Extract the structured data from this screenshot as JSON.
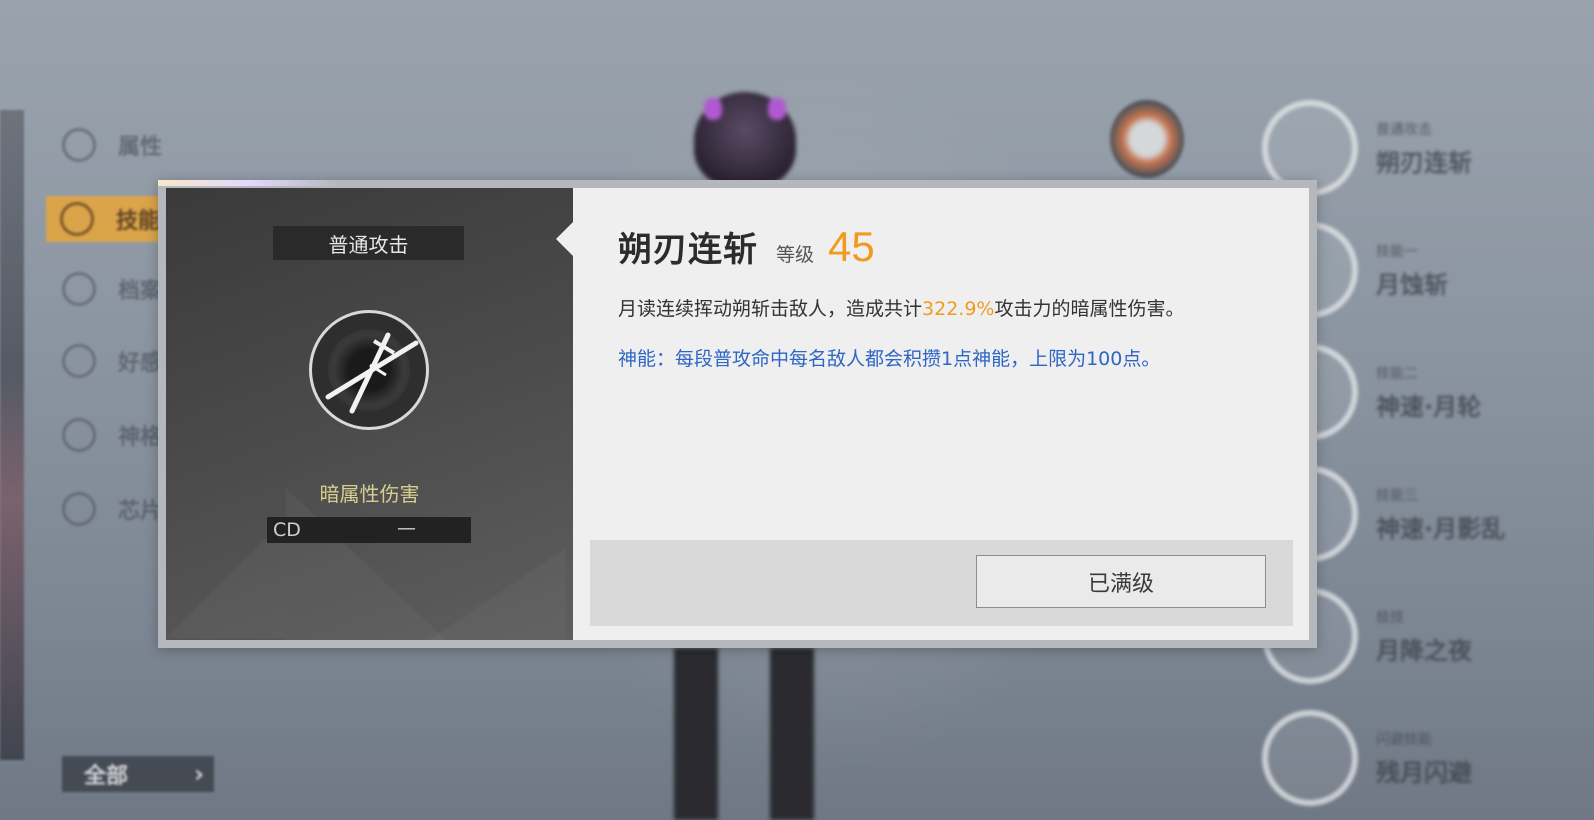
{
  "background": {
    "menu": [
      {
        "label": "属性",
        "active": false
      },
      {
        "label": "技能",
        "active": true
      },
      {
        "label": "档案",
        "active": false
      },
      {
        "label": "好感",
        "active": false
      },
      {
        "label": "神格",
        "active": false
      },
      {
        "label": "芯片",
        "active": false
      }
    ],
    "all_button": "全部",
    "skill_tree": [
      {
        "sub": "普通攻击",
        "name": "朔刃连斩"
      },
      {
        "sub": "技能一",
        "name": "月蚀斩"
      },
      {
        "sub": "技能二",
        "name": "神速·月轮"
      },
      {
        "sub": "技能三",
        "name": "神速·月影乱"
      },
      {
        "sub": "极技",
        "name": "月降之夜"
      },
      {
        "sub": "闪避技能",
        "name": "残月闪避"
      }
    ]
  },
  "dialog": {
    "skill_type": "普通攻击",
    "element": "暗属性伤害",
    "cd_label": "CD",
    "cd_value": "—",
    "skill_name": "朔刃连斩",
    "level_label": "等级",
    "level_value": "45",
    "desc_prefix": "月读连续挥动朔斩击敌人，造成共计",
    "desc_highlight": "322.9%",
    "desc_suffix": "攻击力的暗属性伤害。",
    "extra": "神能：每段普攻命中每名敌人都会积攒1点神能，上限为100点。",
    "max_button": "已满级"
  },
  "colors": {
    "accent_orange": "#f29a1f",
    "extra_blue": "#2f66c4",
    "element_gold": "#d6cf8f",
    "active_menu": "#e8a63a"
  },
  "icons": {
    "skill_icon": "crossed-swords-icon"
  }
}
